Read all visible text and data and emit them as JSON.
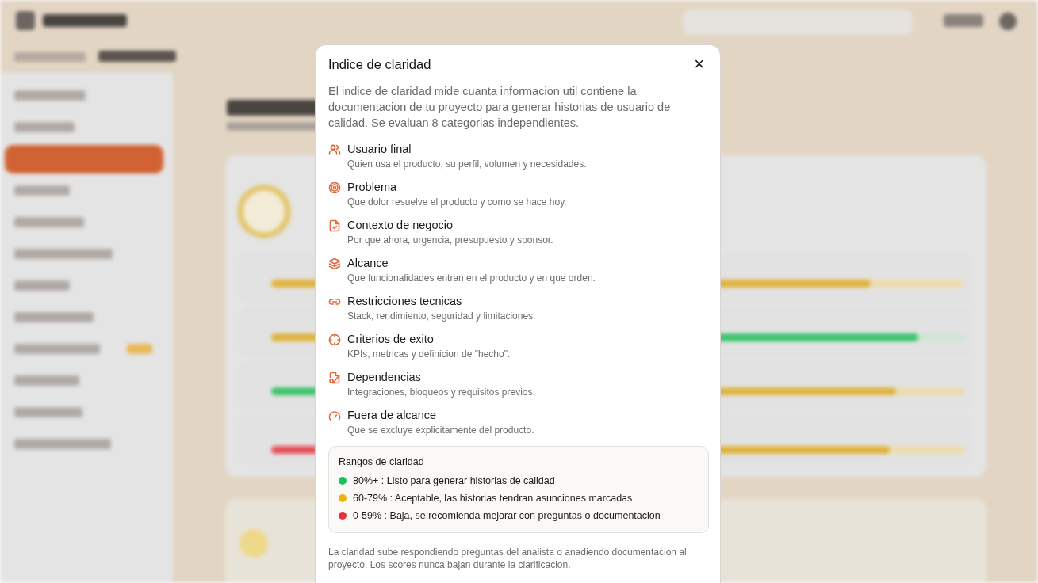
{
  "dialog": {
    "title": "Indice de claridad",
    "close": "×",
    "description": "El indice de claridad mide cuanta informacion util contiene la documentacion de tu proyecto para generar historias de usuario de calidad. Se evaluan 8 categorias independientes.",
    "categories": [
      {
        "title": "Usuario final",
        "text": "Quien usa el producto, su perfil, volumen y necesidades."
      },
      {
        "title": "Problema",
        "text": "Que dolor resuelve el producto y como se hace hoy."
      },
      {
        "title": "Contexto de negocio",
        "text": "Por que ahora, urgencia, presupuesto y sponsor."
      },
      {
        "title": "Alcance",
        "text": "Que funcionalidades entran en el producto y en que orden."
      },
      {
        "title": "Restricciones tecnicas",
        "text": "Stack, rendimiento, seguridad y limitaciones."
      },
      {
        "title": "Criterios de exito",
        "text": "KPIs, metricas y definicion de \"hecho\"."
      },
      {
        "title": "Dependencias",
        "text": "Integraciones, bloqueos y requisitos previos."
      },
      {
        "title": "Fuera de alcance",
        "text": "Que se excluye explicitamente del producto."
      }
    ],
    "ranges": {
      "title": "Rangos de claridad",
      "items": [
        {
          "label": "80%+ : Listo para generar historias de calidad",
          "color": "#16c25a"
        },
        {
          "label": "60-79% : Aceptable, las historias tendran asunciones marcadas",
          "color": "#f0b400"
        },
        {
          "label": "0-59% : Baja, se recomienda mejorar con preguntas o documentacion",
          "color": "#ee2b3b"
        }
      ]
    },
    "footer": "La claridad sube respondiendo preguntas del analista o anadiendo documentacion al proyecto. Los scores nunca bajan durante la clarificacion."
  }
}
